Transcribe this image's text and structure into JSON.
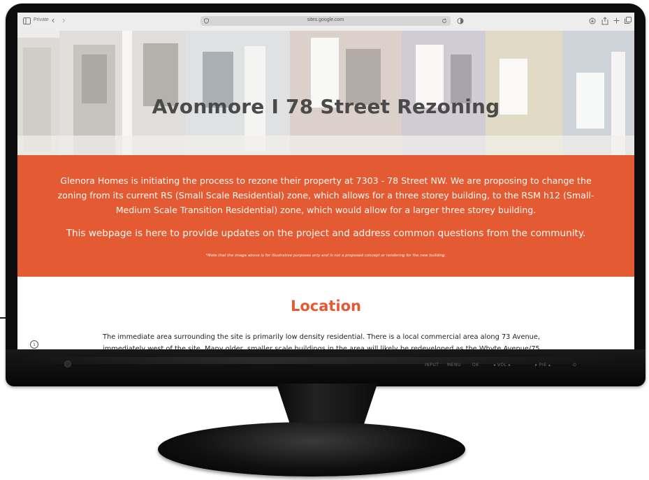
{
  "browser": {
    "private_label": "Private",
    "back_glyph": "‹",
    "forward_glyph": "›",
    "url": "sites.google.com",
    "icons": [
      "sidebar-icon",
      "back-icon",
      "forward-icon",
      "shield-icon",
      "reload-icon",
      "privacy-icon",
      "download-icon",
      "share-icon",
      "new-tab-icon",
      "tabs-icon"
    ]
  },
  "page": {
    "hero_title": "Avonmore I 78 Street Rezoning",
    "intro_paragraph": "Glenora Homes is initiating the process to rezone their property at 7303 - 78 Street NW. We are proposing to change the zoning from its current RS (Small Scale Residential) zone, which allows for a three storey building, to the RSM h12 (Small-Medium Scale Transition Residential) zone, which would allow for a larger three storey building.",
    "purpose_paragraph": "This webpage is here to provide updates on the project and address common questions from the community.",
    "note": "*Note that the image above is for illustrative purposes only and is not a proposed concept or rendering for the new building.",
    "location_heading": "Location",
    "location_text": "The immediate area surrounding the site is primarily low density residential. There is a local commercial area along 73 Avenue, immediately west of the site. Many older, smaller scale buildings in the area will likely be redeveloped as the Whyte Avenue/75"
  },
  "monitor": {
    "controls": [
      "INPUT",
      "MENU",
      "OK",
      "◂ VOL ▸",
      "▸ PIE ▴",
      "⏻"
    ]
  },
  "colors": {
    "accent": "#e45a32",
    "banner_text": "#fffaf5",
    "hero_title": "#4a4a4a",
    "bezel": "#0c0c0c"
  }
}
